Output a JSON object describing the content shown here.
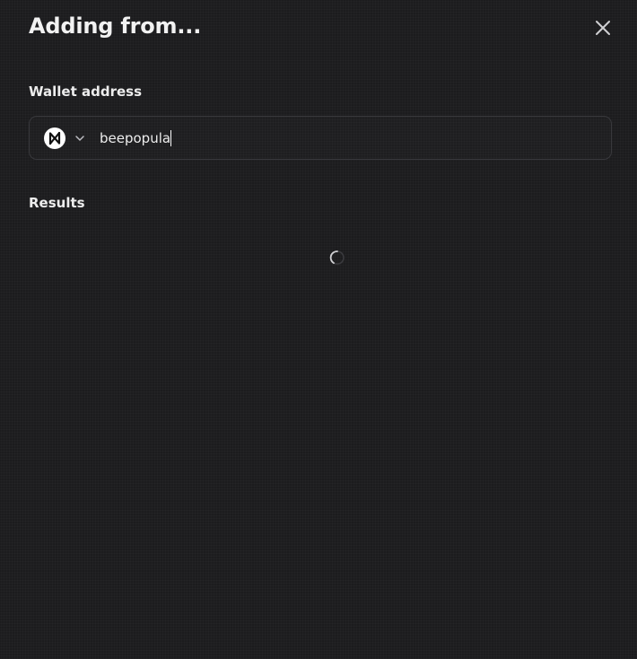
{
  "header": {
    "title": "Adding from..."
  },
  "wallet": {
    "label": "Wallet address",
    "chain_icon": "near-logo-icon",
    "address_value": "beepopula"
  },
  "results": {
    "label": "Results",
    "status_icon": "loading-spinner-icon"
  },
  "colors": {
    "background": "#1c1c1e",
    "border": "#38383c",
    "text": "#ededed"
  }
}
